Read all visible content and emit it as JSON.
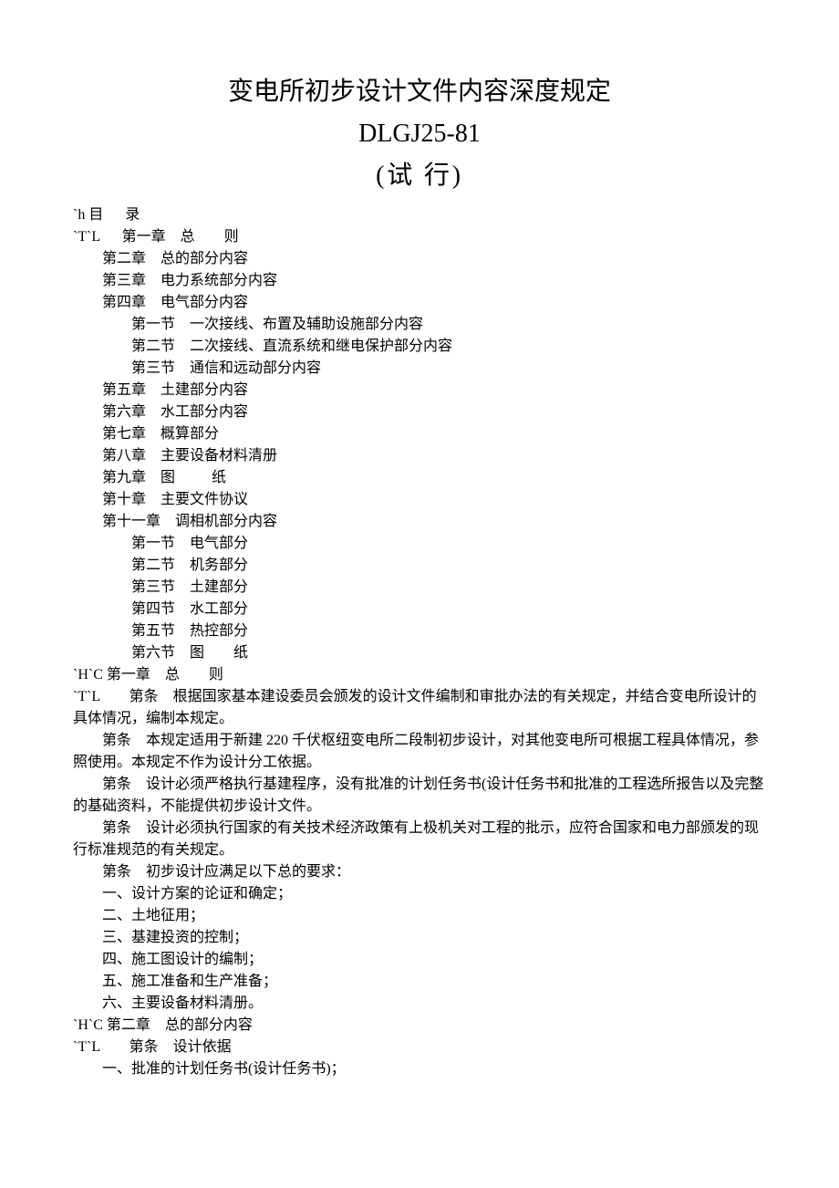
{
  "title": {
    "main": "变电所初步设计文件内容深度规定",
    "code": "DLGJ25-81",
    "status": "(试        行)"
  },
  "toc_header": "`h 目      录",
  "toc_prefix": "`T`L      第一章    总        则",
  "toc_items": [
    "第二章    总的部分内容",
    "第三章    电力系统部分内容",
    "第四章    电气部分内容"
  ],
  "toc_ch4_sub": [
    "第一节    一次接线、布置及辅助设施部分内容",
    "第二节    二次接线、直流系统和继电保护部分内容",
    "第三节    通信和远动部分内容"
  ],
  "toc_items2": [
    "第五章    土建部分内容",
    "第六章    水工部分内容",
    "第七章    概算部分",
    "第八章    主要设备材料清册",
    "第九章    图          纸",
    "第十章    主要文件协议",
    "第十一章    调相机部分内容"
  ],
  "toc_ch11_sub": [
    "第一节    电气部分",
    "第二节    机务部分",
    "第三节    土建部分",
    "第四节    水工部分",
    "第五节    热控部分",
    "第六节    图        纸"
  ],
  "ch1_header": "`H`C 第一章    总        则",
  "ch1_lines": [
    "`T`L        第条    根据国家基本建设委员会颁发的设计文件编制和审批办法的有关规定，并结合变电所设计的具体情况，编制本规定。",
    "        第条    本规定适用于新建 220 千伏枢纽变电所二段制初步设计，对其他变电所可根据工程具体情况，参照使用。本规定不作为设计分工依据。",
    "        第条    设计必须严格执行基建程序，没有批准的计划任务书(设计任务书和批准的工程选所报告以及完整的基础资料，不能提供初步设计文件。",
    "        第条    设计必须执行国家的有关技术经济政策有上极机关对工程的批示，应符合国家和电力部颁发的现行标准规范的有关规定。",
    "        第条    初步设计应满足以下总的要求：",
    "        一、设计方案的论证和确定；",
    "        二、土地征用；",
    "        三、基建投资的控制；",
    "        四、施工图设计的编制；",
    "        五、施工准备和生产准备；",
    "        六、主要设备材料清册。"
  ],
  "ch2_header": "`H`C 第二章    总的部分内容",
  "ch2_lines": [
    "`T`L        第条    设计依据",
    "        一、批准的计划任务书(设计任务书)；"
  ]
}
